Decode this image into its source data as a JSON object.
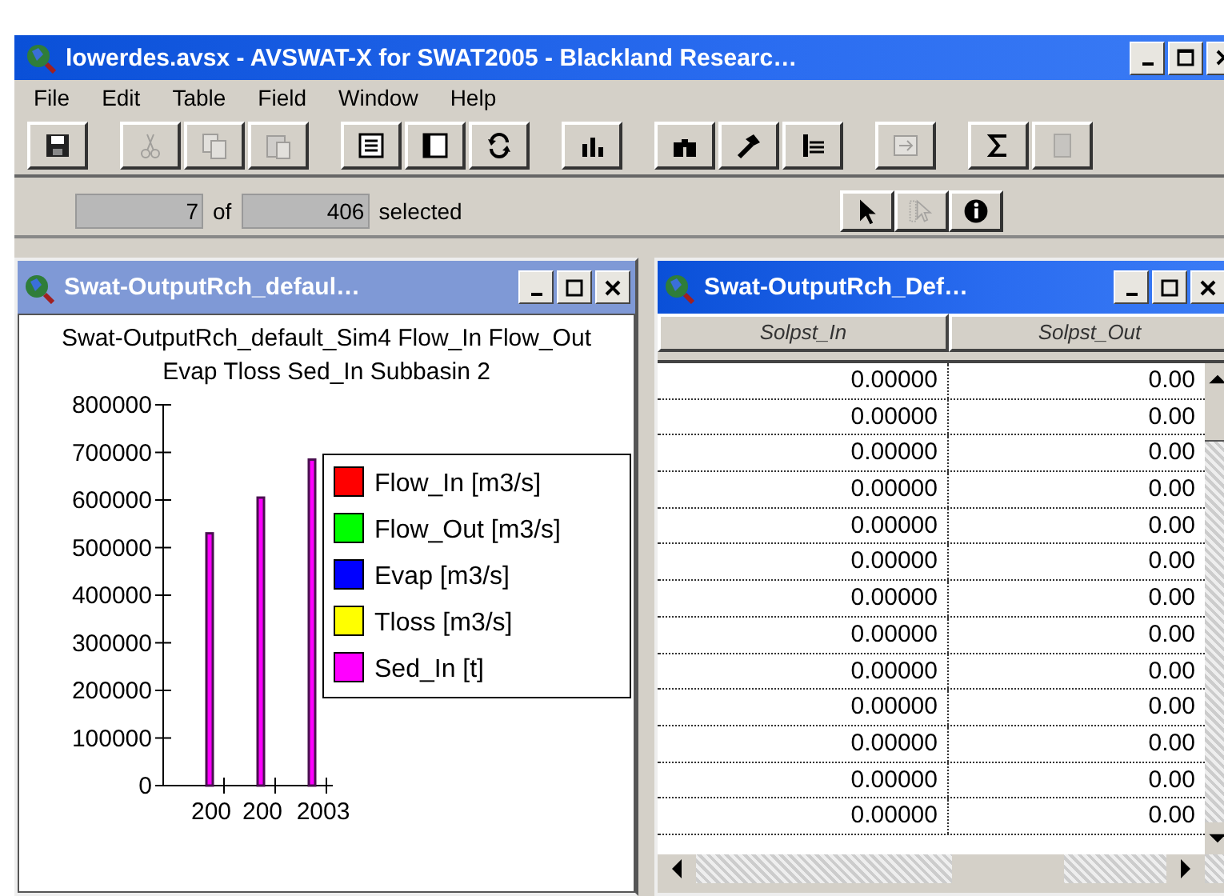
{
  "window": {
    "title": "lowerdes.avsx - AVSWAT-X for SWAT2005 - Blackland Researc…",
    "active": true
  },
  "menu": [
    {
      "label": "File"
    },
    {
      "label": "Edit"
    },
    {
      "label": "Table"
    },
    {
      "label": "Field"
    },
    {
      "label": "Window"
    },
    {
      "label": "Help"
    }
  ],
  "toolbar": [
    [
      {
        "kind": "save",
        "disabled": false
      }
    ],
    [
      {
        "kind": "cut",
        "disabled": true
      },
      {
        "kind": "copy",
        "disabled": true
      },
      {
        "kind": "paste",
        "disabled": true
      }
    ],
    [
      {
        "kind": "list",
        "disabled": false
      },
      {
        "kind": "frame",
        "disabled": false
      },
      {
        "kind": "refresh",
        "disabled": false
      }
    ],
    [
      {
        "kind": "chart",
        "disabled": false
      }
    ],
    [
      {
        "kind": "find",
        "disabled": false
      },
      {
        "kind": "query",
        "disabled": false
      },
      {
        "kind": "promote",
        "disabled": false
      }
    ],
    [
      {
        "kind": "switch",
        "disabled": true
      }
    ],
    [
      {
        "kind": "sum",
        "disabled": false
      },
      {
        "kind": "calc",
        "disabled": true
      }
    ]
  ],
  "status": {
    "count": "7",
    "of": "of",
    "total": "406",
    "suffix": "selected"
  },
  "tools": [
    {
      "kind": "pointer",
      "disabled": false
    },
    {
      "kind": "select",
      "disabled": true
    },
    {
      "kind": "identify",
      "disabled": false
    }
  ],
  "chart_window": {
    "title": "Swat-OutputRch_defaul…",
    "active": false,
    "chart_data": {
      "type": "bar",
      "title": "Swat-OutputRch_default_Sim4 Flow_In Flow_Out Evap Tloss Sed_In Subbasin 2",
      "categories": [
        "200",
        "200",
        "2003"
      ],
      "series": [
        {
          "name": "Flow_In [m3/s]",
          "color": "#ff0000",
          "values": [
            null,
            null,
            null
          ]
        },
        {
          "name": "Flow_Out [m3/s]",
          "color": "#00ff00",
          "values": [
            null,
            null,
            null
          ]
        },
        {
          "name": "Evap [m3/s]",
          "color": "#0000ff",
          "values": [
            null,
            null,
            null
          ]
        },
        {
          "name": "Tloss [m3/s]",
          "color": "#ffff00",
          "values": [
            null,
            null,
            null
          ]
        },
        {
          "name": "Sed_In [t]",
          "color": "#ff00ff",
          "values": [
            530000,
            605000,
            685000
          ]
        }
      ],
      "ylim": [
        0,
        800000
      ],
      "yticks": [
        0,
        100000,
        200000,
        300000,
        400000,
        500000,
        600000,
        700000,
        800000
      ]
    }
  },
  "table_window": {
    "title": "Swat-OutputRch_Def…",
    "active": true,
    "columns": [
      "Solpst_In",
      "Solpst_Out"
    ],
    "rows": [
      [
        "0.00000",
        "0.00"
      ],
      [
        "0.00000",
        "0.00"
      ],
      [
        "0.00000",
        "0.00"
      ],
      [
        "0.00000",
        "0.00"
      ],
      [
        "0.00000",
        "0.00"
      ],
      [
        "0.00000",
        "0.00"
      ],
      [
        "0.00000",
        "0.00"
      ],
      [
        "0.00000",
        "0.00"
      ],
      [
        "0.00000",
        "0.00"
      ],
      [
        "0.00000",
        "0.00"
      ],
      [
        "0.00000",
        "0.00"
      ],
      [
        "0.00000",
        "0.00"
      ],
      [
        "0.00000",
        "0.00"
      ]
    ]
  }
}
